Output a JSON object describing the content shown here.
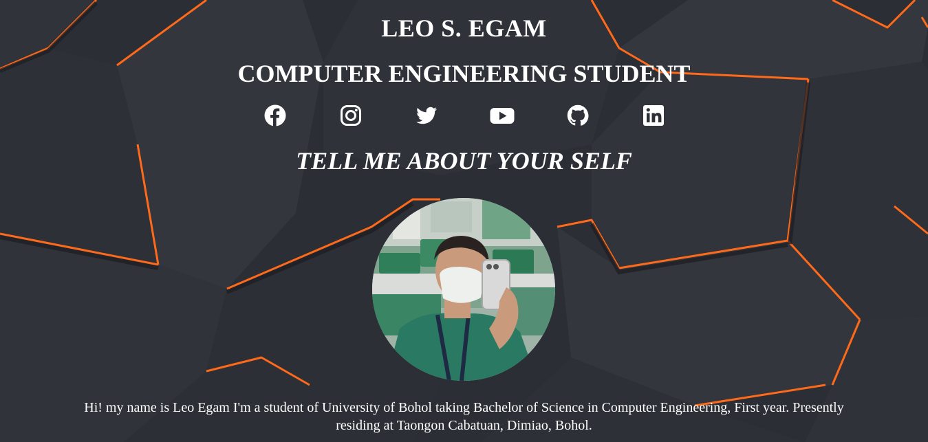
{
  "profile": {
    "name": "LEO S. EGAM",
    "role": "COMPUTER ENGINEERING STUDENT",
    "about_heading": "TELL ME ABOUT YOUR SELF",
    "bio": "Hi! my name is Leo Egam I'm a student of University of Bohol taking Bachelor of Science in Computer Engineering, First year. Presently residing at Taongon Cabatuan, Dimiao, Bohol."
  },
  "social_links": [
    {
      "icon": "facebook-icon"
    },
    {
      "icon": "instagram-icon"
    },
    {
      "icon": "twitter-icon"
    },
    {
      "icon": "youtube-icon"
    },
    {
      "icon": "github-icon"
    },
    {
      "icon": "linkedin-icon"
    }
  ],
  "colors": {
    "background": "#2c2f36",
    "accent": "#ff6a1a",
    "text": "#ffffff"
  }
}
